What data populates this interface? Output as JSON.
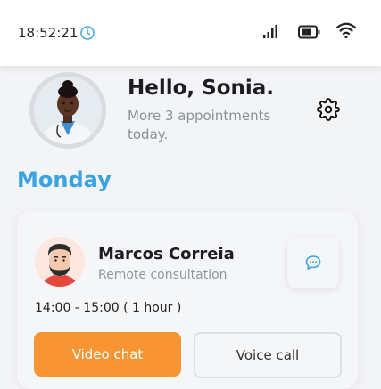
{
  "status_bar": {
    "time": "18:52:21",
    "icons": [
      "clock-icon",
      "signal-icon",
      "battery-icon",
      "wifi-icon"
    ]
  },
  "header": {
    "greeting": "Hello, Sonia.",
    "subtitle": "More 3 appointments today.",
    "settings_icon": "gear-icon"
  },
  "schedule": {
    "day": "Monday",
    "appointment": {
      "doctor_name": "Marcos Correia",
      "type": "Remote consultation",
      "time": "14:00 - 15:00 ( 1 hour )",
      "video_label": "Video chat",
      "voice_label": "Voice call"
    }
  },
  "colors": {
    "accent_blue": "#3aa3e3",
    "accent_orange": "#f79433",
    "background": "#f3f4f6"
  }
}
